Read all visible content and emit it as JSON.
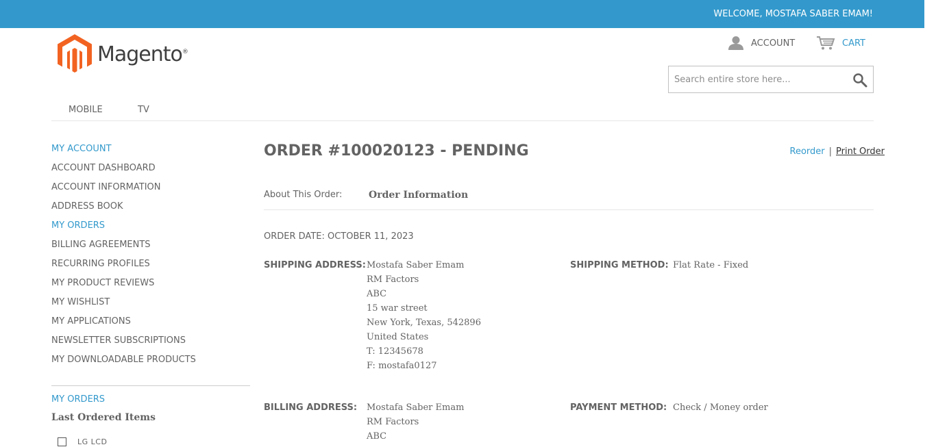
{
  "header": {
    "welcome": "WELCOME, MOSTAFA SABER EMAM!",
    "logo_text": "Magento",
    "logo_reg": "®",
    "account_label": "ACCOUNT",
    "cart_label": "CART",
    "search_placeholder": "Search entire store here...",
    "accent_color": "#3399cc"
  },
  "nav": {
    "items": [
      "MOBILE",
      "TV"
    ]
  },
  "sidebar": {
    "title": "MY ACCOUNT",
    "items": [
      "ACCOUNT DASHBOARD",
      "ACCOUNT INFORMATION",
      "ADDRESS BOOK",
      "MY ORDERS",
      "BILLING AGREEMENTS",
      "RECURRING PROFILES",
      "MY PRODUCT REVIEWS",
      "MY WISHLIST",
      "MY APPLICATIONS",
      "NEWSLETTER SUBSCRIPTIONS",
      "MY DOWNLOADABLE PRODUCTS"
    ],
    "active_item": "MY ORDERS",
    "orders_block": {
      "title": "MY ORDERS",
      "subtitle": "Last Ordered Items",
      "items": [
        "LG LCD"
      ]
    }
  },
  "order": {
    "title": "ORDER #100020123 - PENDING",
    "reorder_label": "Reorder",
    "separator": "|",
    "print_label": "Print Order",
    "about_label": "About This Order:",
    "about_value": "Order Information",
    "order_date": "ORDER DATE: OCTOBER 11, 2023",
    "shipping_address_label": "SHIPPING ADDRESS:",
    "shipping_address": [
      "Mostafa Saber Emam",
      "RM Factors",
      "ABC",
      "15 war street",
      "New York, Texas, 542896",
      "United States",
      "T: 12345678",
      "F: mostafa0127"
    ],
    "shipping_method_label": "SHIPPING METHOD:",
    "shipping_method": "Flat Rate - Fixed",
    "billing_address_label": "BILLING ADDRESS:",
    "billing_address": [
      "Mostafa Saber Emam",
      "RM Factors",
      "ABC"
    ],
    "payment_method_label": "PAYMENT METHOD:",
    "payment_method": "Check / Money order"
  }
}
